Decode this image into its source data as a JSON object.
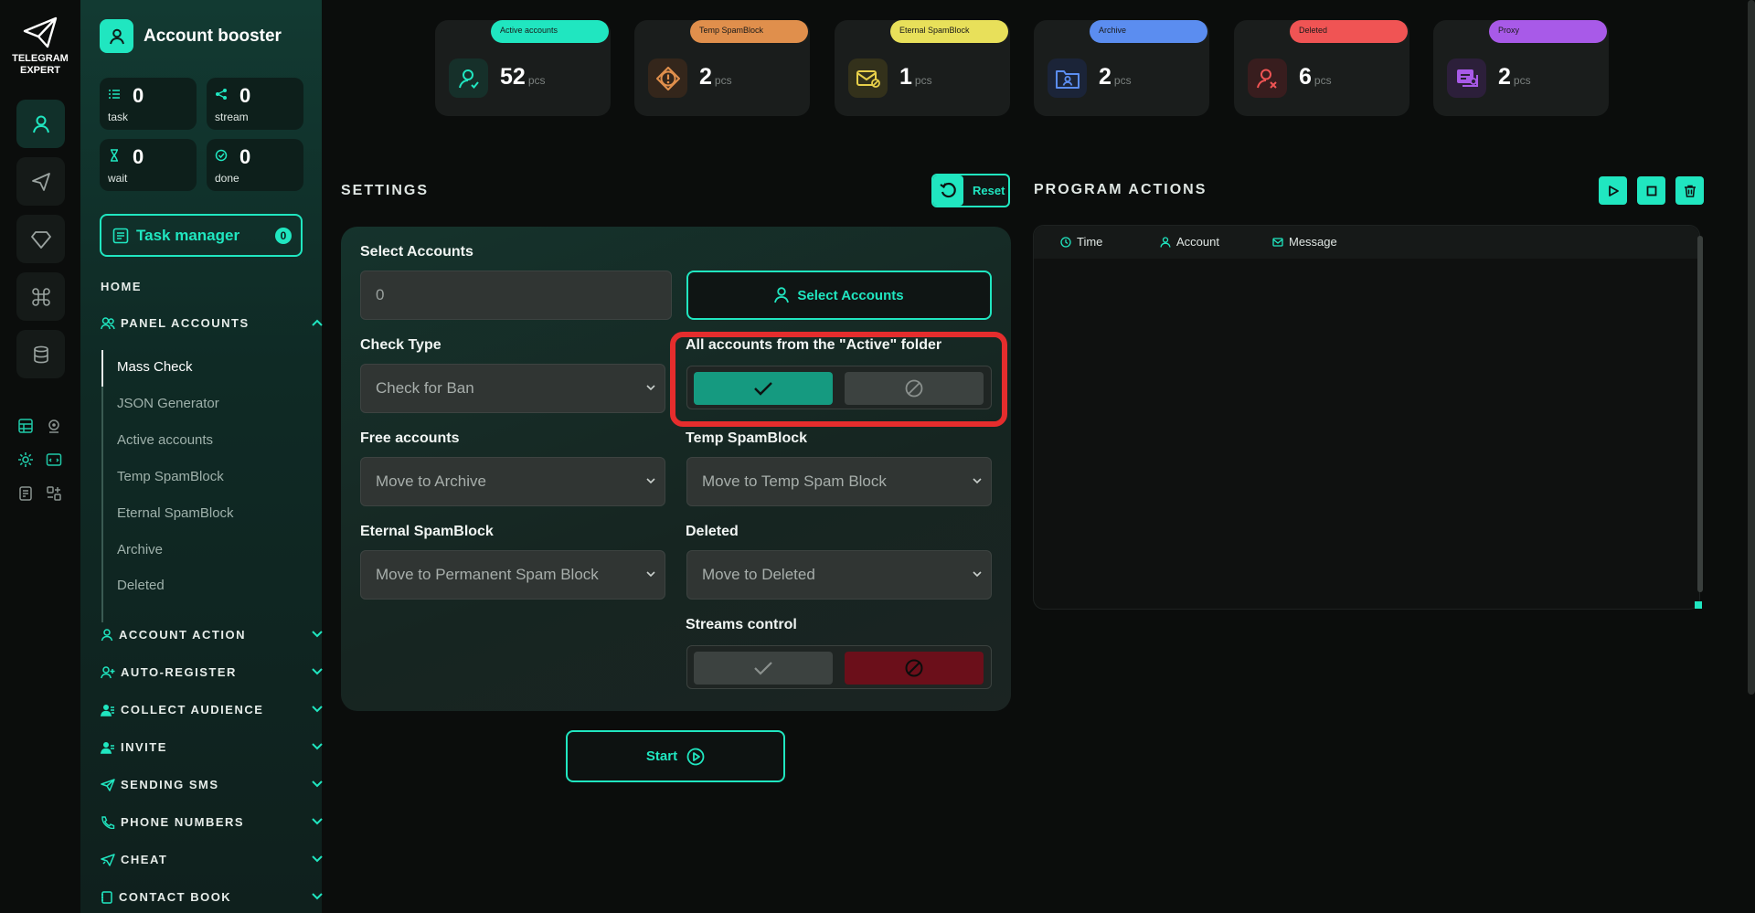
{
  "app": {
    "logo_text": "TELEGRAM EXPERT",
    "brand": "Account booster"
  },
  "stats": [
    {
      "value": "0",
      "label": "task"
    },
    {
      "value": "0",
      "label": "stream"
    },
    {
      "value": "0",
      "label": "wait"
    },
    {
      "value": "0",
      "label": "done"
    }
  ],
  "task_manager": {
    "label": "Task manager",
    "count": "0"
  },
  "nav": {
    "home": "HOME",
    "panel_accounts": "PANEL ACCOUNTS",
    "subitems": [
      "Mass Check",
      "JSON Generator",
      "Active accounts",
      "Temp SpamBlock",
      "Eternal SpamBlock",
      "Archive",
      "Deleted"
    ],
    "sections": [
      "ACCOUNT ACTION",
      "AUTO-REGISTER",
      "COLLECT AUDIENCE",
      "INVITE",
      "SENDING SMS",
      "PHONE NUMBERS",
      "CHEAT",
      "CONTACT BOOK"
    ]
  },
  "cards": [
    {
      "badge": "Active accounts",
      "value": "52",
      "unit": "pcs",
      "color": "#20e6c0",
      "icon": "user-icon"
    },
    {
      "badge": "Temp SpamBlock",
      "value": "2",
      "unit": "pcs",
      "color": "#e08f4c",
      "icon": "warning-icon"
    },
    {
      "badge": "Eternal SpamBlock",
      "value": "1",
      "unit": "pcs",
      "color": "#e8e05a",
      "icon": "mail-block-icon"
    },
    {
      "badge": "Archive",
      "value": "2",
      "unit": "pcs",
      "color": "#5b8df0",
      "icon": "folder-user-icon"
    },
    {
      "badge": "Deleted",
      "value": "6",
      "unit": "pcs",
      "color": "#f05454",
      "icon": "user-x-icon"
    },
    {
      "badge": "Proxy",
      "value": "2",
      "unit": "pcs",
      "color": "#a85ae8",
      "icon": "proxy-icon"
    }
  ],
  "settings": {
    "title": "SETTINGS",
    "reset": "Reset",
    "select_accounts_label": "Select Accounts",
    "select_accounts_value": "0",
    "select_accounts_button": "Select Accounts",
    "check_type_label": "Check Type",
    "check_type_value": "Check for Ban",
    "active_folder_label": "All accounts from the \"Active\" folder",
    "free_label": "Free accounts",
    "free_value": "Move to Archive",
    "temp_label": "Temp SpamBlock",
    "temp_value": "Move to Temp Spam Block",
    "eternal_label": "Eternal SpamBlock",
    "eternal_value": "Move to Permanent Spam Block",
    "deleted_label": "Deleted",
    "deleted_value": "Move to Deleted",
    "streams_label": "Streams control",
    "start": "Start"
  },
  "actions": {
    "title": "PROGRAM ACTIONS",
    "columns": [
      "Time",
      "Account",
      "Message"
    ]
  },
  "colors": {
    "accent": "#20e6c0",
    "highlight": "#e52d2d",
    "danger": "#6b0f1a"
  }
}
